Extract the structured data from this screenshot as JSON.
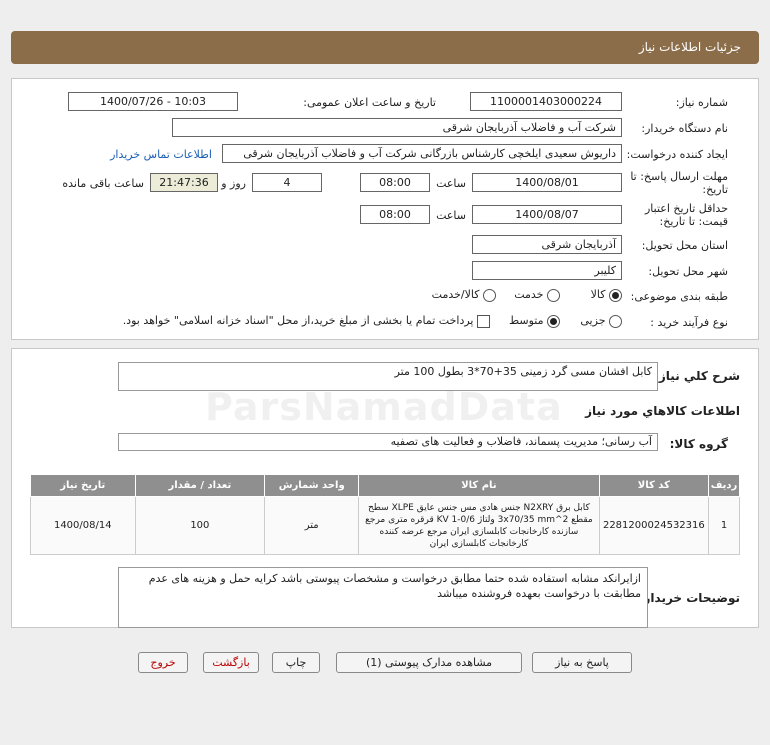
{
  "header": {
    "title": "جزئیات اطلاعات نیاز"
  },
  "info": {
    "need_number_label": "شماره نیاز:",
    "need_number": "1100001403000224",
    "announce_label": "تاریخ و ساعت اعلان عمومی:",
    "announce_value": "1400/07/26 - 10:03",
    "buyer_label": "نام دستگاه خریدار:",
    "buyer_value": "شرکت آب و فاضلاب آذربایجان شرقی",
    "creator_label": "ایجاد کننده درخواست:",
    "creator_value": "داریوش سعیدی ایلخچی کارشناس بازرگانی شرکت آب و فاضلاب آذربایجان شرقی",
    "contact_link": "اطلاعات تماس خریدار",
    "deadline_label_1": "مهلت ارسال پاسخ: تا",
    "deadline_label_2": "تاریخ:",
    "deadline_date": "1400/08/01",
    "time_label": "ساعت",
    "deadline_time": "08:00",
    "days_value": "4",
    "days_label": "روز و",
    "remaining_time": "21:47:36",
    "remaining_label": "ساعت باقی مانده",
    "validity_label_1": "حداقل تاریخ اعتبار",
    "validity_label_2": "قیمت: تا تاریخ:",
    "validity_date": "1400/08/07",
    "validity_time": "08:00",
    "province_label": "استان محل تحویل:",
    "province_value": "آذربایجان شرقی",
    "city_label": "شهر محل تحویل:",
    "city_value": "کلیبر",
    "category_label": "طبقه بندی موضوعی:",
    "category_options": [
      "کالا",
      "خدمت",
      "کالا/خدمت"
    ],
    "category_selected": "کالا",
    "process_label": "نوع فرآیند خرید :",
    "process_options": [
      "جزیی",
      "متوسط"
    ],
    "process_selected": "متوسط",
    "payment_note": "پرداخت تمام یا بخشی از مبلغ خرید،از محل \"اسناد خزانه اسلامی\" خواهد بود."
  },
  "summary": {
    "label": "شرح کلي نياز:",
    "value": "کابل افشان مسی گرد زمینی 35+70*3 بطول 100 متر"
  },
  "goods": {
    "section_title": "اطلاعات كالاهاي مورد نياز",
    "group_label": "گروه کالا:",
    "group_value": "آب رسانی؛ مدیریت پسماند، فاضلاب و فعالیت های تصفیه",
    "columns": [
      "ردیف",
      "کد کالا",
      "نام کالا",
      "واحد شمارش",
      "تعداد / مقدار",
      "تاریخ نیاز"
    ],
    "rows": [
      {
        "row": "1",
        "code": "2281200024532316",
        "name": "کابل برق N2XRY جنس هادی مس جنس عایق XLPE سطح مقطع 3x70/35 mm^2 ولتاژ KV 1-0/6 قرقره متری مرجع سازنده کارخانجات کابلسازی ایران مرجع عرضه کننده کارخانجات کابلسازی ایران",
        "unit": "متر",
        "qty": "100",
        "date": "1400/08/14"
      }
    ]
  },
  "buyer_notes": {
    "label": "توضیحات خریدار:",
    "value": "ازایرانکد مشابه استفاده شده حتما مطابق درخواست و مشخصات پیوستی باشد کرایه حمل و هزینه های عدم مطابقت با درخواست بعهده فروشنده میباشد"
  },
  "buttons": {
    "reply": "پاسخ به نیاز",
    "view_docs": "مشاهده مدارک پیوستی (1)",
    "print": "چاپ",
    "back": "بازگشت",
    "exit": "خروج"
  },
  "watermark": {
    "text": "ParsNamadData"
  }
}
